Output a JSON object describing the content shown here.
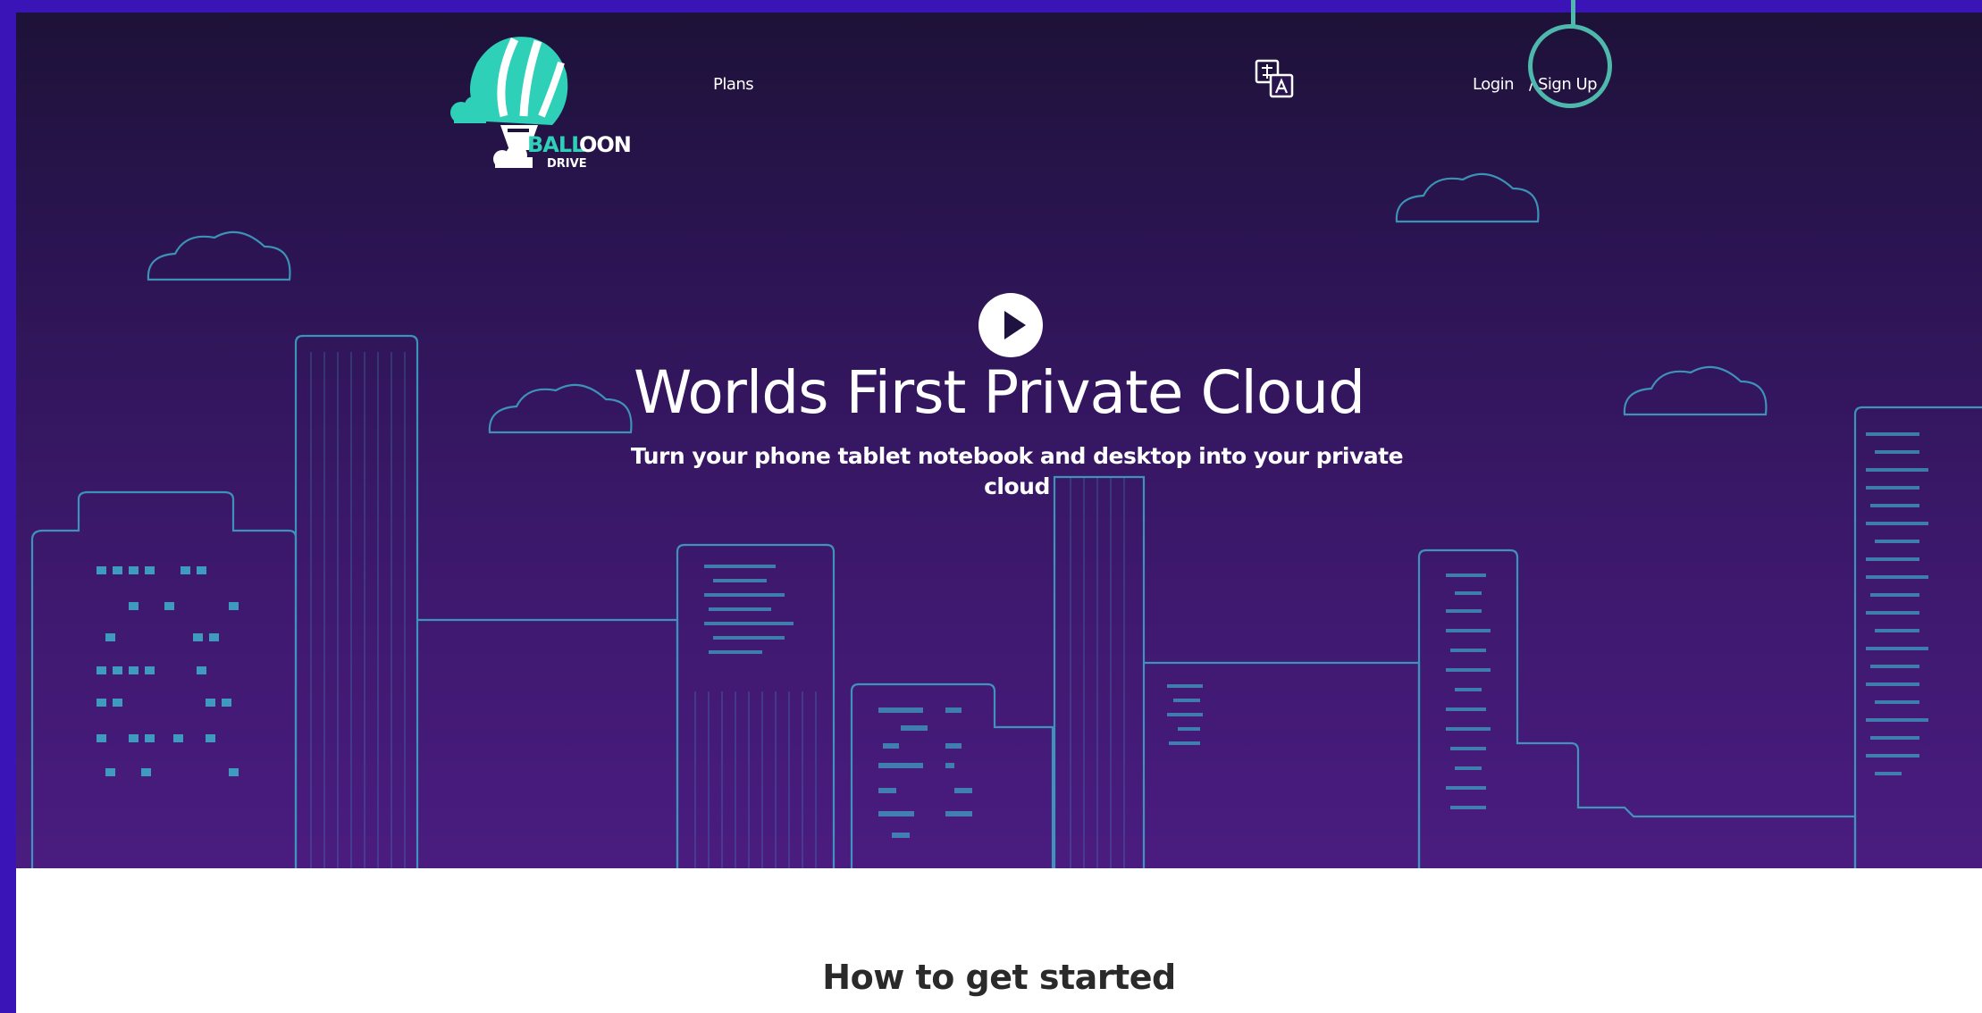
{
  "nav": {
    "logo_top": "BALL",
    "logo_accent": "OON",
    "logo_sub": "DRIVE",
    "plans_label": "Plans",
    "login_label": "Login",
    "separator": "/",
    "signup_label": "Sign Up",
    "language_icon": "translate-icon"
  },
  "hero": {
    "play_icon": "play-icon",
    "headline": "Worlds First Private Cloud",
    "tagline": "Turn your phone tablet notebook and desktop into your private cloud"
  },
  "section": {
    "heading": "How to get started"
  },
  "colors": {
    "frame": "#3a14b6",
    "hero_top": "#1d1238",
    "hero_bottom": "#4a1c80",
    "accent": "#4fb8ad",
    "building_line": "#3fa8c8"
  }
}
